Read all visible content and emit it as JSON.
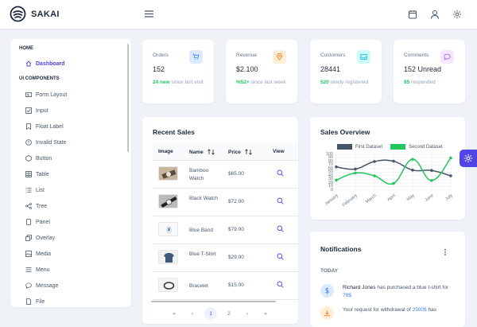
{
  "app": {
    "name": "SAKAI"
  },
  "sidebar": {
    "sections": [
      {
        "title": "HOME",
        "items": [
          {
            "label": "Dashboard",
            "icon": "home-icon"
          }
        ]
      },
      {
        "title": "UI COMPONENTS",
        "items": [
          {
            "label": "Form Layout",
            "icon": "id-card-icon"
          },
          {
            "label": "Input",
            "icon": "check-square-icon"
          },
          {
            "label": "Float Label",
            "icon": "bookmark-icon"
          },
          {
            "label": "Invalid State",
            "icon": "exclamation-circle-icon"
          },
          {
            "label": "Button",
            "icon": "box-icon"
          },
          {
            "label": "Table",
            "icon": "table-icon"
          },
          {
            "label": "List",
            "icon": "list-icon"
          },
          {
            "label": "Tree",
            "icon": "share-icon"
          },
          {
            "label": "Panel",
            "icon": "tablet-icon"
          },
          {
            "label": "Overlay",
            "icon": "clone-icon"
          },
          {
            "label": "Media",
            "icon": "image-icon"
          },
          {
            "label": "Menu",
            "icon": "bars-icon"
          },
          {
            "label": "Message",
            "icon": "comment-icon"
          },
          {
            "label": "File",
            "icon": "file-icon"
          }
        ]
      }
    ]
  },
  "stats": [
    {
      "title": "Orders",
      "value": "152",
      "highlight": "24 new",
      "sub": "since last visit",
      "icon": "shopping-cart-icon",
      "bg": "#dbeafe",
      "fg": "#3b82f6"
    },
    {
      "title": "Revenue",
      "value": "$2.100",
      "highlight": "%52+",
      "sub": "since last week",
      "icon": "map-marker-icon",
      "bg": "#ffedd5",
      "fg": "#f97316"
    },
    {
      "title": "Customers",
      "value": "28441",
      "highlight": "520",
      "sub": "newly registered",
      "icon": "inbox-icon",
      "bg": "#cffafe",
      "fg": "#06b6d4"
    },
    {
      "title": "Comments",
      "value": "152 Unread",
      "highlight": "85",
      "sub": "responded",
      "icon": "comment-icon",
      "bg": "#f3e8ff",
      "fg": "#a855f7"
    }
  ],
  "recent_sales": {
    "title": "Recent Sales",
    "columns": [
      "Image",
      "Name",
      "Price",
      "View"
    ],
    "rows": [
      {
        "name": "Bamboo Watch",
        "price": "$65.00"
      },
      {
        "name": "Black Watch",
        "price": "$72.00"
      },
      {
        "name": "Blue Band",
        "price": "$79.00"
      },
      {
        "name": "Blue T-Shirt",
        "price": "$29.00"
      },
      {
        "name": "Bracelet",
        "price": "$15.00"
      }
    ],
    "pagination": {
      "first": "«",
      "prev": "‹",
      "pages": [
        "1",
        "2"
      ],
      "current": "1",
      "next": "›",
      "last": "»"
    }
  },
  "sales_overview": {
    "title": "Sales Overview",
    "chart_data": {
      "type": "line",
      "x": [
        "January",
        "February",
        "March",
        "April",
        "May",
        "June",
        "July"
      ],
      "ylim": [
        0,
        100
      ],
      "yticks": [
        "100",
        "90",
        "80",
        "70",
        "60",
        "50",
        "40",
        "30",
        "20",
        "10",
        "0"
      ],
      "grid": true,
      "legend": "top",
      "series": [
        {
          "name": "First Dataset",
          "values": [
            65,
            59,
            80,
            81,
            56,
            55,
            40
          ],
          "color": "#475569"
        },
        {
          "name": "Second Dataset",
          "values": [
            28,
            48,
            40,
            19,
            86,
            27,
            90
          ],
          "color": "#22c55e"
        }
      ]
    }
  },
  "notifications": {
    "title": "Notifications",
    "group": "TODAY",
    "items": [
      {
        "name": "Richard Jones",
        "text": "has purchased a blue t-shirt for",
        "amount": "79$",
        "icon": "dollar-icon",
        "bg": "#dbeafe",
        "fg": "#3b82f6"
      },
      {
        "text_pre": "Your request for withdrawal of",
        "amount": "2500$",
        "text_post": "has",
        "icon": "download-icon",
        "bg": "#ffedd5",
        "fg": "#f97316"
      }
    ]
  }
}
